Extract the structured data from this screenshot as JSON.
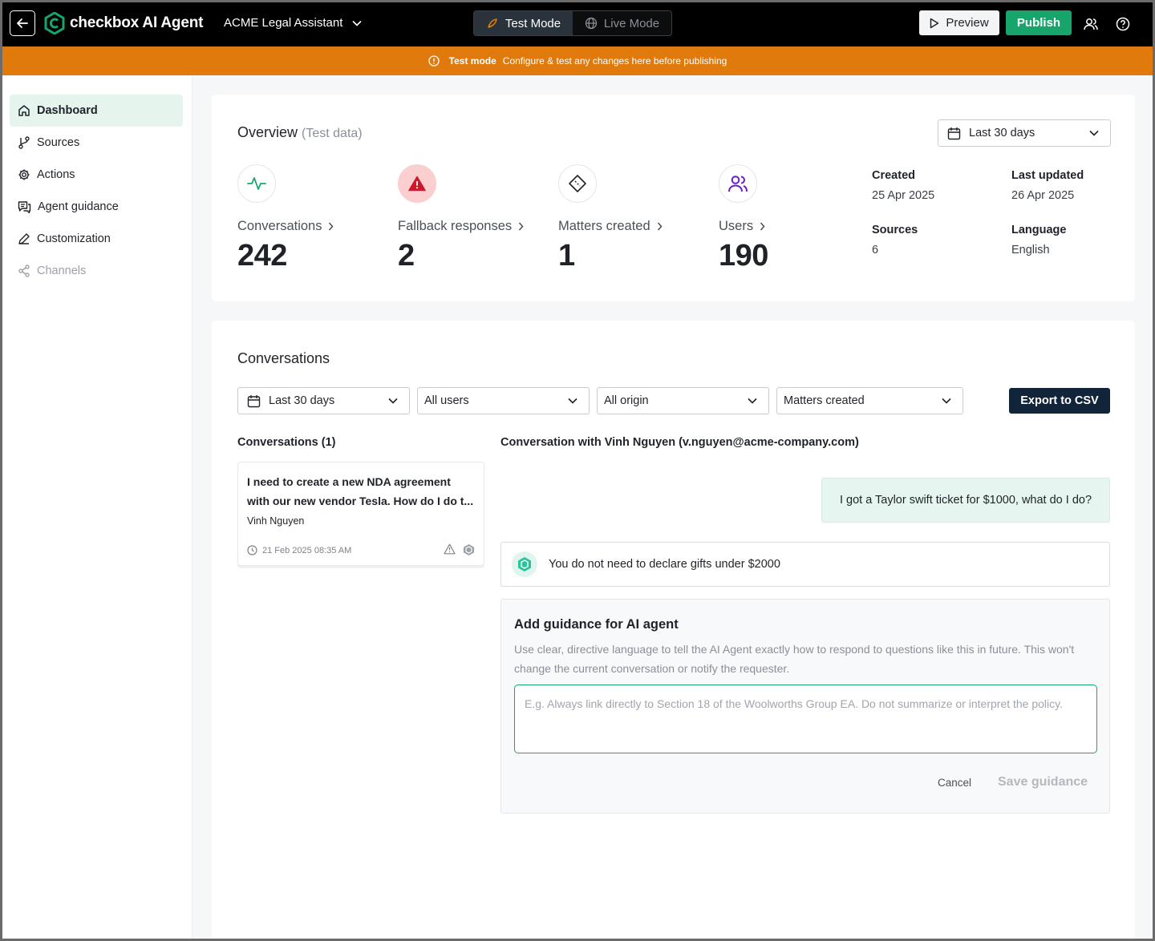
{
  "topbar": {
    "logo_text": "checkbox AI Agent",
    "agent_name": "ACME Legal Assistant",
    "modes": [
      {
        "label": "Test Mode",
        "active": true,
        "icon": "rocket-icon"
      },
      {
        "label": "Live Mode",
        "active": false,
        "icon": "globe-icon"
      }
    ],
    "preview_label": "Preview",
    "publish_label": "Publish",
    "brand_color": "#17a56b"
  },
  "banner": {
    "title": "Test mode",
    "message": "Configure & test any changes here before publishing",
    "color": "#e07a0c"
  },
  "sidebar": {
    "items": [
      {
        "label": "Dashboard",
        "icon": "home-icon",
        "active": true
      },
      {
        "label": "Sources",
        "icon": "branch-icon"
      },
      {
        "label": "Actions",
        "icon": "gear-icon"
      },
      {
        "label": "Agent guidance",
        "icon": "chat-icon"
      },
      {
        "label": "Customization",
        "icon": "pen-icon"
      },
      {
        "label": "Channels",
        "icon": "share-icon",
        "disabled": true
      }
    ]
  },
  "overview": {
    "title": "Overview",
    "subtitle": "(Test data)",
    "date_range": "Last 30 days",
    "stats": [
      {
        "label": "Conversations",
        "value": "242",
        "icon": "activity-icon"
      },
      {
        "label": "Fallback responses",
        "value": "2",
        "icon": "warning-icon"
      },
      {
        "label": "Matters created",
        "value": "1",
        "icon": "ticket-icon"
      },
      {
        "label": "Users",
        "value": "190",
        "icon": "users-icon"
      }
    ],
    "meta": {
      "created_label": "Created",
      "created_value": "25 Apr 2025",
      "updated_label": "Last updated",
      "updated_value": "26 Apr 2025",
      "sources_label": "Sources",
      "sources_value": "6",
      "language_label": "Language",
      "language_value": "English"
    }
  },
  "conversations": {
    "title": "Conversations",
    "filters": {
      "date": "Last 30 days",
      "users": "All users",
      "origin": "All origin",
      "matters": "Matters created"
    },
    "export_label": "Export to CSV",
    "list_heading": "Conversations (1)",
    "items": [
      {
        "title_line1": "I need to create a new NDA agreement",
        "title_line2": "with our new vendor Tesla. How do I do t...",
        "user": "Vinh Nguyen",
        "timestamp": "21 Feb 2025 08:35 AM"
      }
    ],
    "detail_heading": "Conversation with Vinh Nguyen (v.nguyen@acme-company.com)",
    "user_message": "I got a Taylor swift ticket for $1000, what do I do?",
    "bot_message": "You do not need to declare gifts under $2000",
    "guidance": {
      "title": "Add guidance for AI agent",
      "description": "Use clear, directive language to tell the AI Agent exactly how to respond to questions like this in future. This won't change the current conversation or notify the requester.",
      "placeholder": "E.g. Always link directly to Section 18 of the Woolworths Group EA. Do not summarize or interpret the policy.",
      "cancel_label": "Cancel",
      "save_label": "Save guidance"
    }
  }
}
